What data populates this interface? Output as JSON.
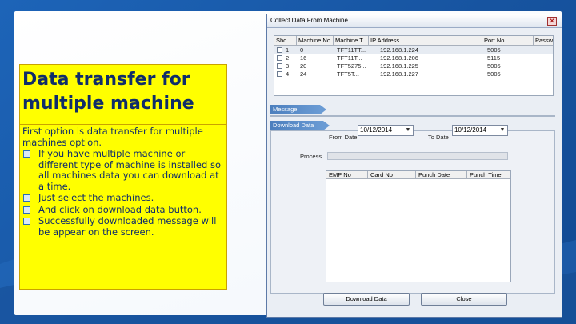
{
  "callout": {
    "title": "Data transfer for multiple machine",
    "intro": "First option is data transfer for multiple machines option.",
    "bullets": [
      "If you have multiple machine or different type of machine is installed so all machines data you can download at a time.",
      "Just select the machines.",
      "And click on download data button.",
      "Successfully downloaded message will be appear on the screen."
    ]
  },
  "dialog": {
    "title": "Collect Data From Machine",
    "close_glyph": "✕",
    "machine_grid": {
      "columns": [
        "Sho",
        "Machine No",
        "Machine T",
        "IP Address",
        "Port No",
        "Passwo"
      ],
      "rows": [
        {
          "sno": "1",
          "machine_no": "0",
          "machine_type": "TFT11TT...",
          "ip": "192.168.1.224",
          "port": "5005"
        },
        {
          "sno": "2",
          "machine_no": "16",
          "machine_type": "TFT11T...",
          "ip": "192.168.1.206",
          "port": "5115"
        },
        {
          "sno": "3",
          "machine_no": "20",
          "machine_type": "TFT5275...",
          "ip": "192.168.1.225",
          "port": "5005"
        },
        {
          "sno": "4",
          "machine_no": "24",
          "machine_type": "TFT5T...",
          "ip": "192.168.1.227",
          "port": "5005"
        }
      ]
    },
    "message_label": "Message",
    "download_section_label": "Download Data",
    "from_date_label": "From Date",
    "from_date_value": "10/12/2014",
    "to_date_label": "To Date",
    "to_date_value": "10/12/2014",
    "process_label": "Process",
    "result_columns": [
      "EMP No",
      "Card No",
      "Punch Date",
      "Punch Time"
    ],
    "download_button": "Download Data",
    "close_button": "Close",
    "dropdown_glyph": "▼"
  }
}
